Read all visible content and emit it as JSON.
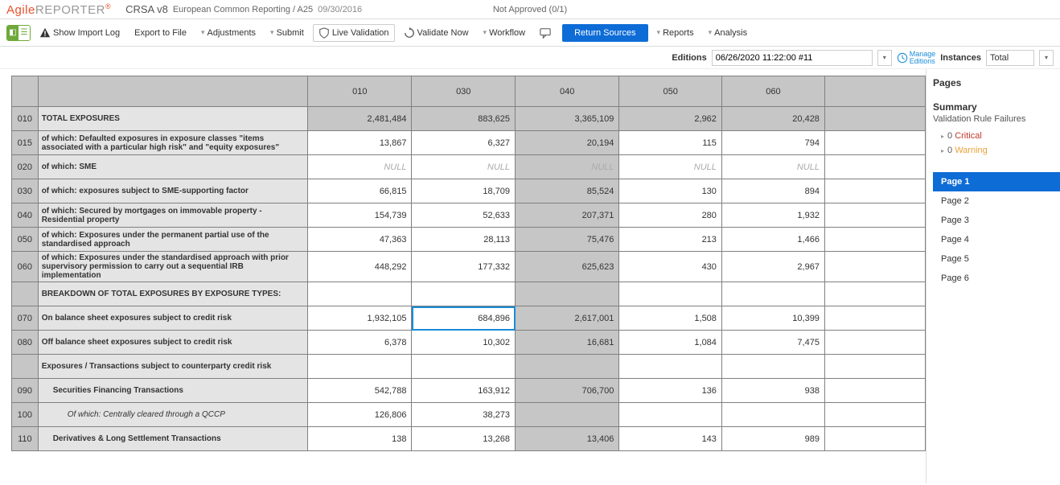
{
  "header": {
    "logo_a": "Agile",
    "logo_rep": "REPORTER",
    "crsa": "CRSA v8",
    "crumb": "European Common Reporting / A25",
    "date": "09/30/2016",
    "status": "Not Approved (0/1)"
  },
  "toolbar": {
    "show_import_log": "Show Import Log",
    "export_to_file": "Export to File",
    "adjustments": "Adjustments",
    "submit": "Submit",
    "live_validation": "Live Validation",
    "validate_now": "Validate Now",
    "workflow": "Workflow",
    "return_sources": "Return Sources",
    "reports": "Reports",
    "analysis": "Analysis"
  },
  "editions": {
    "label": "Editions",
    "value": "06/26/2020 11:22:00 #11",
    "manage": "Manage",
    "editions": "Editions",
    "instances_label": "Instances",
    "instances_value": "Total"
  },
  "grid": {
    "columns": [
      "010",
      "030",
      "040",
      "050",
      "060"
    ],
    "rows": [
      {
        "id": "010",
        "label": "TOTAL EXPOSURES",
        "vals": [
          "2,481,484",
          "883,625",
          "3,365,109",
          "2,962",
          "20,428"
        ],
        "shade": true
      },
      {
        "id": "015",
        "label": "of which: Defaulted exposures in exposure classes \"items associated with a particular high risk\" and \"equity exposures\"",
        "vals": [
          "13,867",
          "6,327",
          "20,194",
          "115",
          "794"
        ]
      },
      {
        "id": "020",
        "label": "of which: SME",
        "vals": [
          "NULL",
          "NULL",
          "NULL",
          "NULL",
          "NULL"
        ],
        "nul": true
      },
      {
        "id": "030",
        "label": "of which: exposures subject to SME-supporting factor",
        "vals": [
          "66,815",
          "18,709",
          "85,524",
          "130",
          "894"
        ]
      },
      {
        "id": "040",
        "label": "of which: Secured by mortgages on immovable property - Residential property",
        "vals": [
          "154,739",
          "52,633",
          "207,371",
          "280",
          "1,932"
        ]
      },
      {
        "id": "050",
        "label": "of which: Exposures under the permanent partial use of the standardised approach",
        "vals": [
          "47,363",
          "28,113",
          "75,476",
          "213",
          "1,466"
        ]
      },
      {
        "id": "060",
        "label": "of which: Exposures under the standardised approach with prior supervisory permission to carry out a sequential IRB implementation",
        "vals": [
          "448,292",
          "177,332",
          "625,623",
          "430",
          "2,967"
        ]
      },
      {
        "section": true,
        "label": "BREAKDOWN OF TOTAL EXPOSURES BY EXPOSURE TYPES:"
      },
      {
        "id": "070",
        "label": "On balance sheet exposures subject to credit risk",
        "vals": [
          "1,932,105",
          "684,896",
          "2,617,001",
          "1,508",
          "10,399"
        ],
        "sel": 1
      },
      {
        "id": "080",
        "label": "Off balance sheet exposures subject to credit risk",
        "vals": [
          "6,378",
          "10,302",
          "16,681",
          "1,084",
          "7,475"
        ]
      },
      {
        "section": true,
        "label": "Exposures / Transactions subject to counterparty credit risk"
      },
      {
        "id": "090",
        "label": "Securities Financing Transactions",
        "indent": 1,
        "vals": [
          "542,788",
          "163,912",
          "706,700",
          "136",
          "938"
        ]
      },
      {
        "id": "100",
        "label": "Of which: Centrally cleared through a QCCP",
        "indent": 2,
        "vals": [
          "126,806",
          "38,273",
          "",
          "",
          ""
        ]
      },
      {
        "id": "110",
        "label": "Derivatives & Long Settlement Transactions",
        "indent": 1,
        "vals": [
          "138",
          "13,268",
          "13,406",
          "143",
          "989"
        ]
      }
    ]
  },
  "side": {
    "pages_title": "Pages",
    "summary": "Summary",
    "vrf": "Validation Rule Failures",
    "zero": "0",
    "critical": "Critical",
    "warning": "Warning",
    "pages": [
      "Page 1",
      "Page 2",
      "Page 3",
      "Page 4",
      "Page 5",
      "Page 6"
    ],
    "active": 0
  }
}
